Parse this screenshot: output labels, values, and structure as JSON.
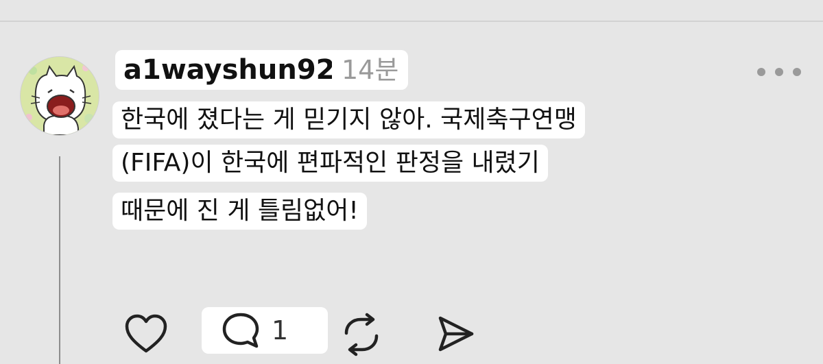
{
  "post": {
    "username": "a1wayshun92",
    "time": "14분",
    "text_lines": [
      "한국에 졌다는 게 믿기지 않아. 국제축구연맹",
      "(FIFA)이 한국에 편파적인 판정을 내렸기",
      "때문에 진 게 틀림없어!"
    ],
    "reply_count": "1"
  },
  "icons": {
    "avatar": "cat-avatar-icon",
    "more": "more-icon",
    "like": "heart-icon",
    "reply": "comment-icon",
    "repost": "repost-icon",
    "share": "send-icon"
  },
  "colors": {
    "background": "#e6e6e6",
    "label_background": "#ffffff",
    "muted": "#9a9a9a"
  }
}
